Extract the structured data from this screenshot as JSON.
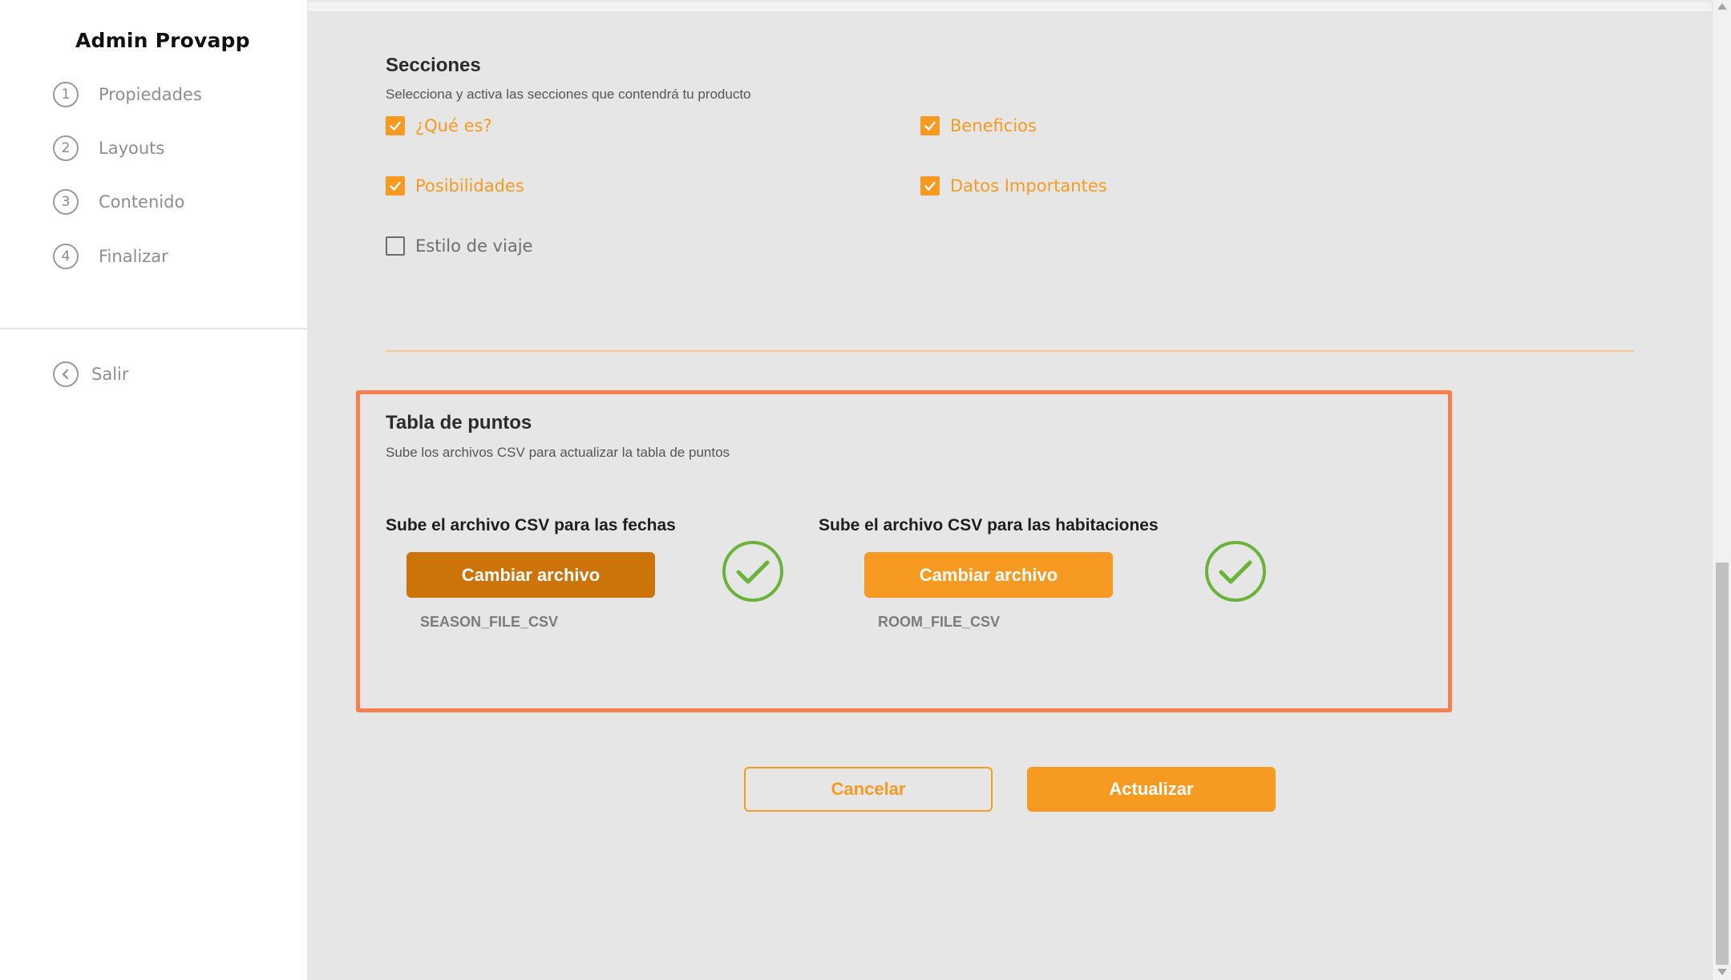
{
  "app": {
    "title": "Admin Provapp"
  },
  "sidebar": {
    "steps": [
      {
        "number": "1",
        "label": "Propiedades"
      },
      {
        "number": "2",
        "label": "Layouts"
      },
      {
        "number": "3",
        "label": "Contenido"
      },
      {
        "number": "4",
        "label": "Finalizar"
      }
    ],
    "exit_label": "Salir"
  },
  "secciones": {
    "title": "Secciones",
    "subtitle": "Selecciona y activa las secciones que contendrá tu producto",
    "options": [
      {
        "label": "¿Qué es?",
        "checked": true
      },
      {
        "label": "Beneficios",
        "checked": true
      },
      {
        "label": "Posibilidades",
        "checked": true
      },
      {
        "label": "Datos Importantes",
        "checked": true
      },
      {
        "label": "Estilo de viaje",
        "checked": false
      }
    ]
  },
  "tabla": {
    "title": "Tabla de puntos",
    "subtitle": "Sube los archivos CSV para actualizar la tabla de puntos",
    "uploads": [
      {
        "title": "Sube el archivo CSV para las fechas",
        "button_label": "Cambiar archivo",
        "file_name": "SEASON_FILE_CSV"
      },
      {
        "title": "Sube el archivo CSV para las habitaciones",
        "button_label": "Cambiar archivo",
        "file_name": "ROOM_FILE_CSV"
      }
    ]
  },
  "actions": {
    "cancel_label": "Cancelar",
    "update_label": "Actualizar"
  },
  "colors": {
    "accent": "#f79a21",
    "accent_dark": "#cc7309",
    "highlight": "#f97d4d",
    "success": "#6ab23a"
  }
}
